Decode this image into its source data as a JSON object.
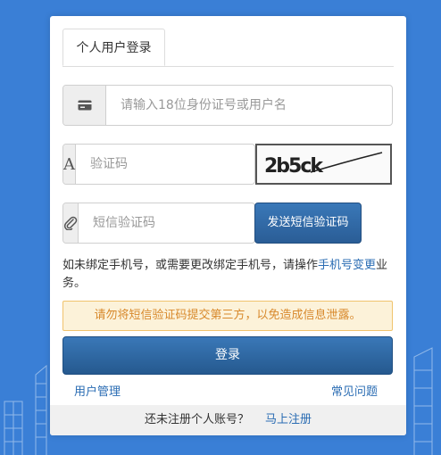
{
  "tabs": [
    {
      "label": "个人用户登录"
    }
  ],
  "username": {
    "placeholder": "请输入18位身份证号或用户名",
    "icon": "id-card-icon"
  },
  "captcha": {
    "placeholder": "验证码",
    "icon_glyph": "A",
    "image_text": "2b5ck"
  },
  "sms": {
    "placeholder": "短信验证码",
    "icon": "paperclip-icon",
    "send_label": "发送短信验证码"
  },
  "notice": {
    "before": "如未绑定手机号，或需要更改绑定手机号，请操作",
    "link": "手机号变更",
    "after": "业务。"
  },
  "warning": "请勿将短信验证码提交第三方，以免造成信息泄露。",
  "login_label": "登录",
  "links": {
    "user_management": "用户管理",
    "faq": "常见问题"
  },
  "footer": {
    "text": "还未注册个人账号？",
    "register": "马上注册"
  },
  "colors": {
    "background": "#3a7fd6",
    "primary": "#2a5d96",
    "link": "#2a6cb3",
    "warning_text": "#d8892c"
  }
}
